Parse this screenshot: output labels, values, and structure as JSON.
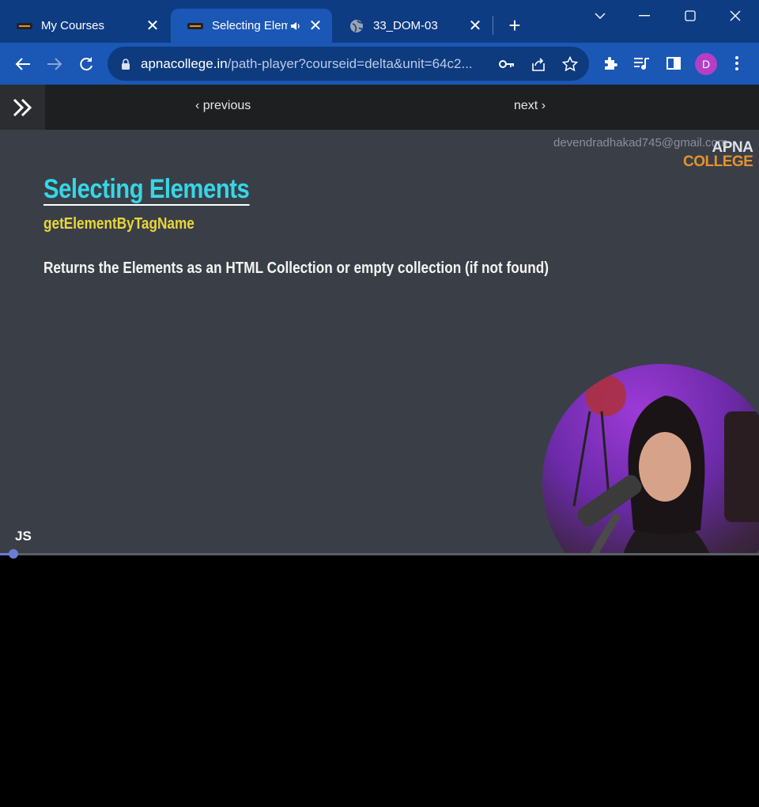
{
  "browser": {
    "tabs": [
      {
        "title": "My Courses",
        "active": false,
        "favicon": "college-logo-icon"
      },
      {
        "title": "Selecting Elem",
        "active": true,
        "favicon": "college-logo-icon",
        "audio": true
      },
      {
        "title": "33_DOM-03",
        "active": false,
        "favicon": "globe-icon"
      }
    ],
    "url_domain": "apnacollege.in",
    "url_path": "/path-player?courseid=delta&unit=64c2...",
    "profile_initial": "D",
    "colors": {
      "titlebar": "#0e3c83",
      "toolbar": "#1b57b5",
      "omnibox": "#0d3b7d",
      "avatar": "#b43fc7"
    }
  },
  "page_nav": {
    "previous_label": "previous",
    "next_label": "next"
  },
  "video": {
    "watermark_email": "devendradhakad745@gmail.com",
    "logo_top": "APNA",
    "logo_bottom": "COLLEGE",
    "slide_title": "Selecting Elements",
    "slide_subtitle": "getElementByTagName",
    "slide_description": "Returns the Elements as an HTML Collection or empty collection (if not found)",
    "corner_label": "JS",
    "progress_fraction": 0.018,
    "colors": {
      "title": "#37d6e6",
      "subtitle": "#e8d73a",
      "progress": "#6b7bd6"
    }
  }
}
